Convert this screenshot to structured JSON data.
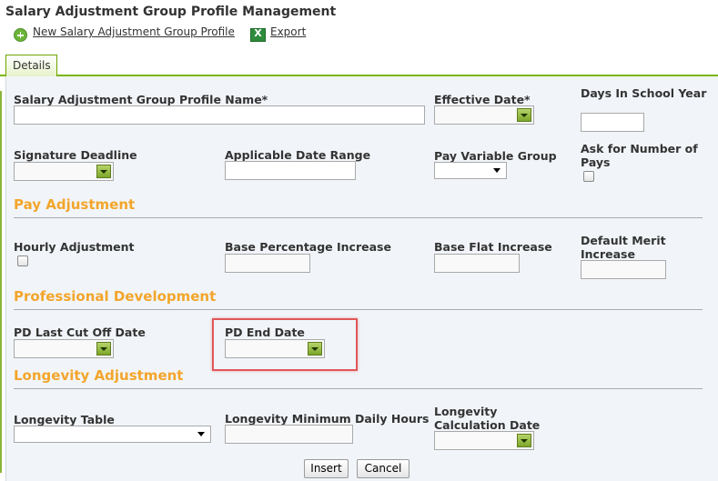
{
  "page": {
    "title": "Salary Adjustment Group Profile Management",
    "toolbar": {
      "new_label": "New Salary Adjustment Group Profile",
      "export_label": "Export",
      "new_icon": "add-icon",
      "export_icon": "excel-icon"
    }
  },
  "tabs": [
    {
      "label": "Details",
      "active": true
    }
  ],
  "form": {
    "profile_name": {
      "label": "Salary Adjustment Group Profile Name*",
      "value": ""
    },
    "effective_date": {
      "label": "Effective Date*",
      "value": ""
    },
    "days_in_school_year": {
      "label": "Days In School Year",
      "value": ""
    },
    "signature_deadline": {
      "label": "Signature Deadline",
      "value": ""
    },
    "applicable_date_range": {
      "label": "Applicable Date Range",
      "value": ""
    },
    "pay_variable_group": {
      "label": "Pay Variable Group",
      "value": ""
    },
    "ask_for_number_of_pays": {
      "label": "Ask for Number of Pays",
      "checked": false
    },
    "sections": {
      "pay_adjustment": "Pay Adjustment",
      "professional_development": "Professional Development",
      "longevity_adjustment": "Longevity Adjustment"
    },
    "hourly_adjustment": {
      "label": "Hourly Adjustment",
      "checked": false
    },
    "base_percentage_increase": {
      "label": "Base Percentage Increase",
      "value": ""
    },
    "base_flat_increase": {
      "label": "Base Flat Increase",
      "value": ""
    },
    "default_merit_increase": {
      "label": "Default Merit Increase",
      "value": ""
    },
    "pd_last_cut_off_date": {
      "label": "PD Last Cut Off Date",
      "value": ""
    },
    "pd_end_date": {
      "label": "PD End Date",
      "value": ""
    },
    "longevity_table": {
      "label": "Longevity Table",
      "value": ""
    },
    "longevity_minimum_daily_hours": {
      "label": "Longevity Minimum Daily Hours",
      "value": ""
    },
    "longevity_calculation_date": {
      "label": "Longevity Calculation Date",
      "value": ""
    }
  },
  "actions": {
    "insert_label": "Insert",
    "cancel_label": "Cancel"
  },
  "colors": {
    "accent_green": "#7ab800",
    "section_orange": "#f3a52b",
    "highlight_red": "#e0575a"
  }
}
